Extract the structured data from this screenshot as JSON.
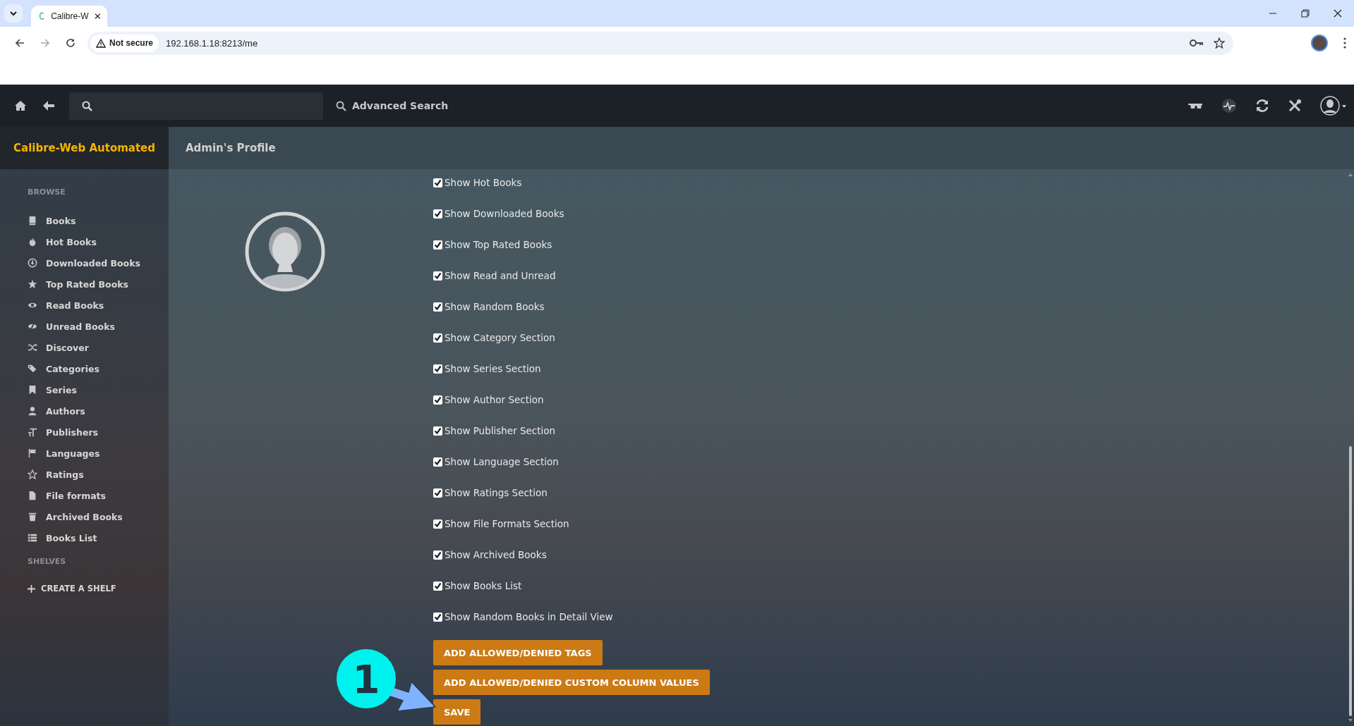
{
  "browser": {
    "tab_title": "Calibre-W",
    "security": "Not secure",
    "url": "192.168.1.18:8213/me"
  },
  "navbar": {
    "advanced_search": "Advanced Search"
  },
  "sidebar": {
    "brand": "Calibre-Web Automated",
    "browse_heading": "BROWSE",
    "items": [
      {
        "label": "Books"
      },
      {
        "label": "Hot Books"
      },
      {
        "label": "Downloaded Books"
      },
      {
        "label": "Top Rated Books"
      },
      {
        "label": "Read Books"
      },
      {
        "label": "Unread Books"
      },
      {
        "label": "Discover"
      },
      {
        "label": "Categories"
      },
      {
        "label": "Series"
      },
      {
        "label": "Authors"
      },
      {
        "label": "Publishers"
      },
      {
        "label": "Languages"
      },
      {
        "label": "Ratings"
      },
      {
        "label": "File formats"
      },
      {
        "label": "Archived Books"
      },
      {
        "label": "Books List"
      }
    ],
    "shelves_heading": "SHELVES",
    "create_shelf": "CREATE A SHELF"
  },
  "page": {
    "title": "Admin's Profile"
  },
  "settings": [
    {
      "label": "Show Hot Books",
      "checked": true
    },
    {
      "label": "Show Downloaded Books",
      "checked": true
    },
    {
      "label": "Show Top Rated Books",
      "checked": true
    },
    {
      "label": "Show Read and Unread",
      "checked": true
    },
    {
      "label": "Show Random Books",
      "checked": true
    },
    {
      "label": "Show Category Section",
      "checked": true
    },
    {
      "label": "Show Series Section",
      "checked": true
    },
    {
      "label": "Show Author Section",
      "checked": true
    },
    {
      "label": "Show Publisher Section",
      "checked": true
    },
    {
      "label": "Show Language Section",
      "checked": true
    },
    {
      "label": "Show Ratings Section",
      "checked": true
    },
    {
      "label": "Show File Formats Section",
      "checked": true
    },
    {
      "label": "Show Archived Books",
      "checked": true
    },
    {
      "label": "Show Books List",
      "checked": true
    },
    {
      "label": "Show Random Books in Detail View",
      "checked": true
    }
  ],
  "buttons": [
    "ADD ALLOWED/DENIED TAGS",
    "ADD ALLOWED/DENIED CUSTOM COLUMN VALUES",
    "SAVE"
  ],
  "annotation": {
    "number": "1"
  }
}
